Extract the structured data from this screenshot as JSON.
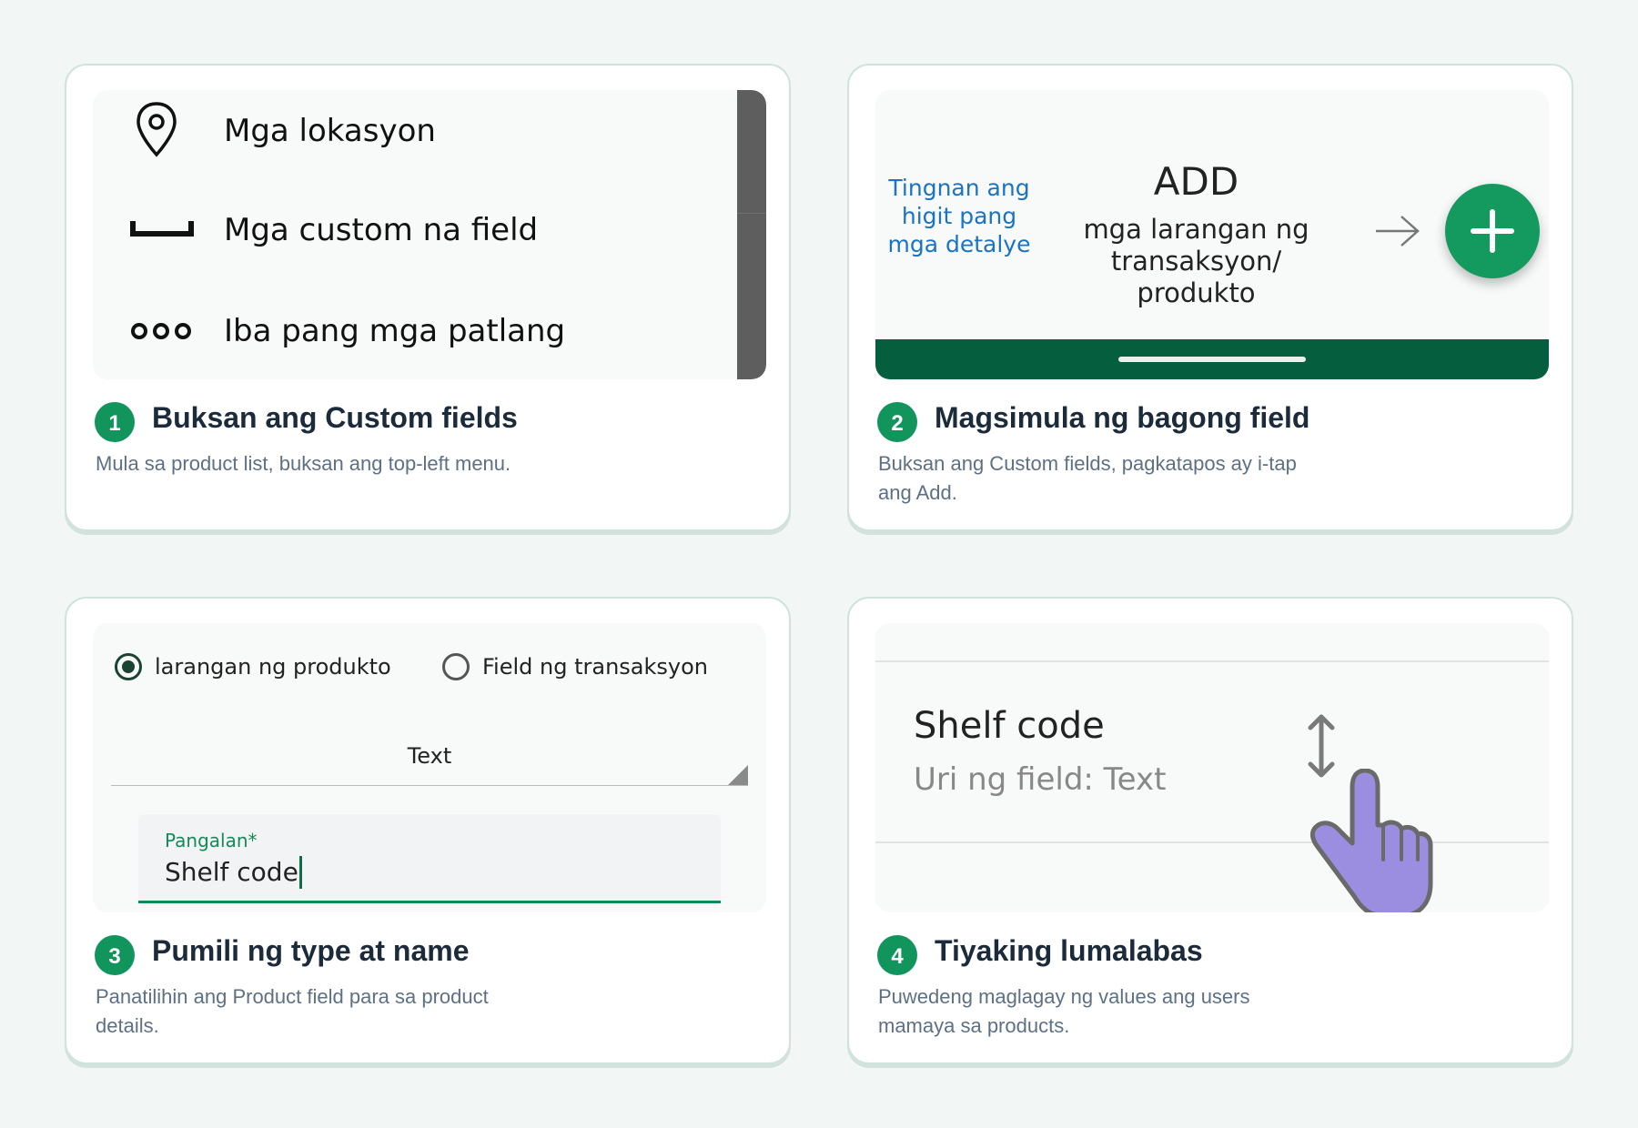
{
  "steps": [
    {
      "number": "1",
      "title": "Buksan ang Custom fields",
      "desc": "Mula sa product list, buksan ang top-left menu.",
      "menu": [
        {
          "icon": "location-pin-icon",
          "label": "Mga lokasyon"
        },
        {
          "icon": "custom-field-icon",
          "label": "Mga custom na field"
        },
        {
          "icon": "more-dots-icon",
          "label": "Iba pang mga patlang"
        }
      ]
    },
    {
      "number": "2",
      "title": "Magsimula ng bagong field",
      "desc": "Buksan ang Custom fields, pagkatapos ay i-tap ang Add.",
      "link": "Tingnan ang higit pang mga detalye",
      "add_title": "ADD",
      "add_sub": "mga larangan ng transaksyon/ produkto",
      "fab_icon": "plus-icon",
      "accent": "#149a5e",
      "bar_color": "#055e3e"
    },
    {
      "number": "3",
      "title": "Pumili ng type at name",
      "desc": "Panatilihin ang Product field para sa product details.",
      "radio_options": [
        {
          "label": "larangan ng produkto",
          "selected": true
        },
        {
          "label": "Field ng transaksyon",
          "selected": false
        }
      ],
      "type_value": "Text",
      "name_label": "Pangalan*",
      "name_value": "Shelf code"
    },
    {
      "number": "4",
      "title": "Tiyaking lumalabas",
      "desc": "Puwedeng maglagay ng values ang users mamaya sa products.",
      "field_name": "Shelf code",
      "field_type": "Uri ng field: Text",
      "drag_icon": "drag-handle-icon",
      "hand_icon": "pointer-hand-icon"
    }
  ]
}
